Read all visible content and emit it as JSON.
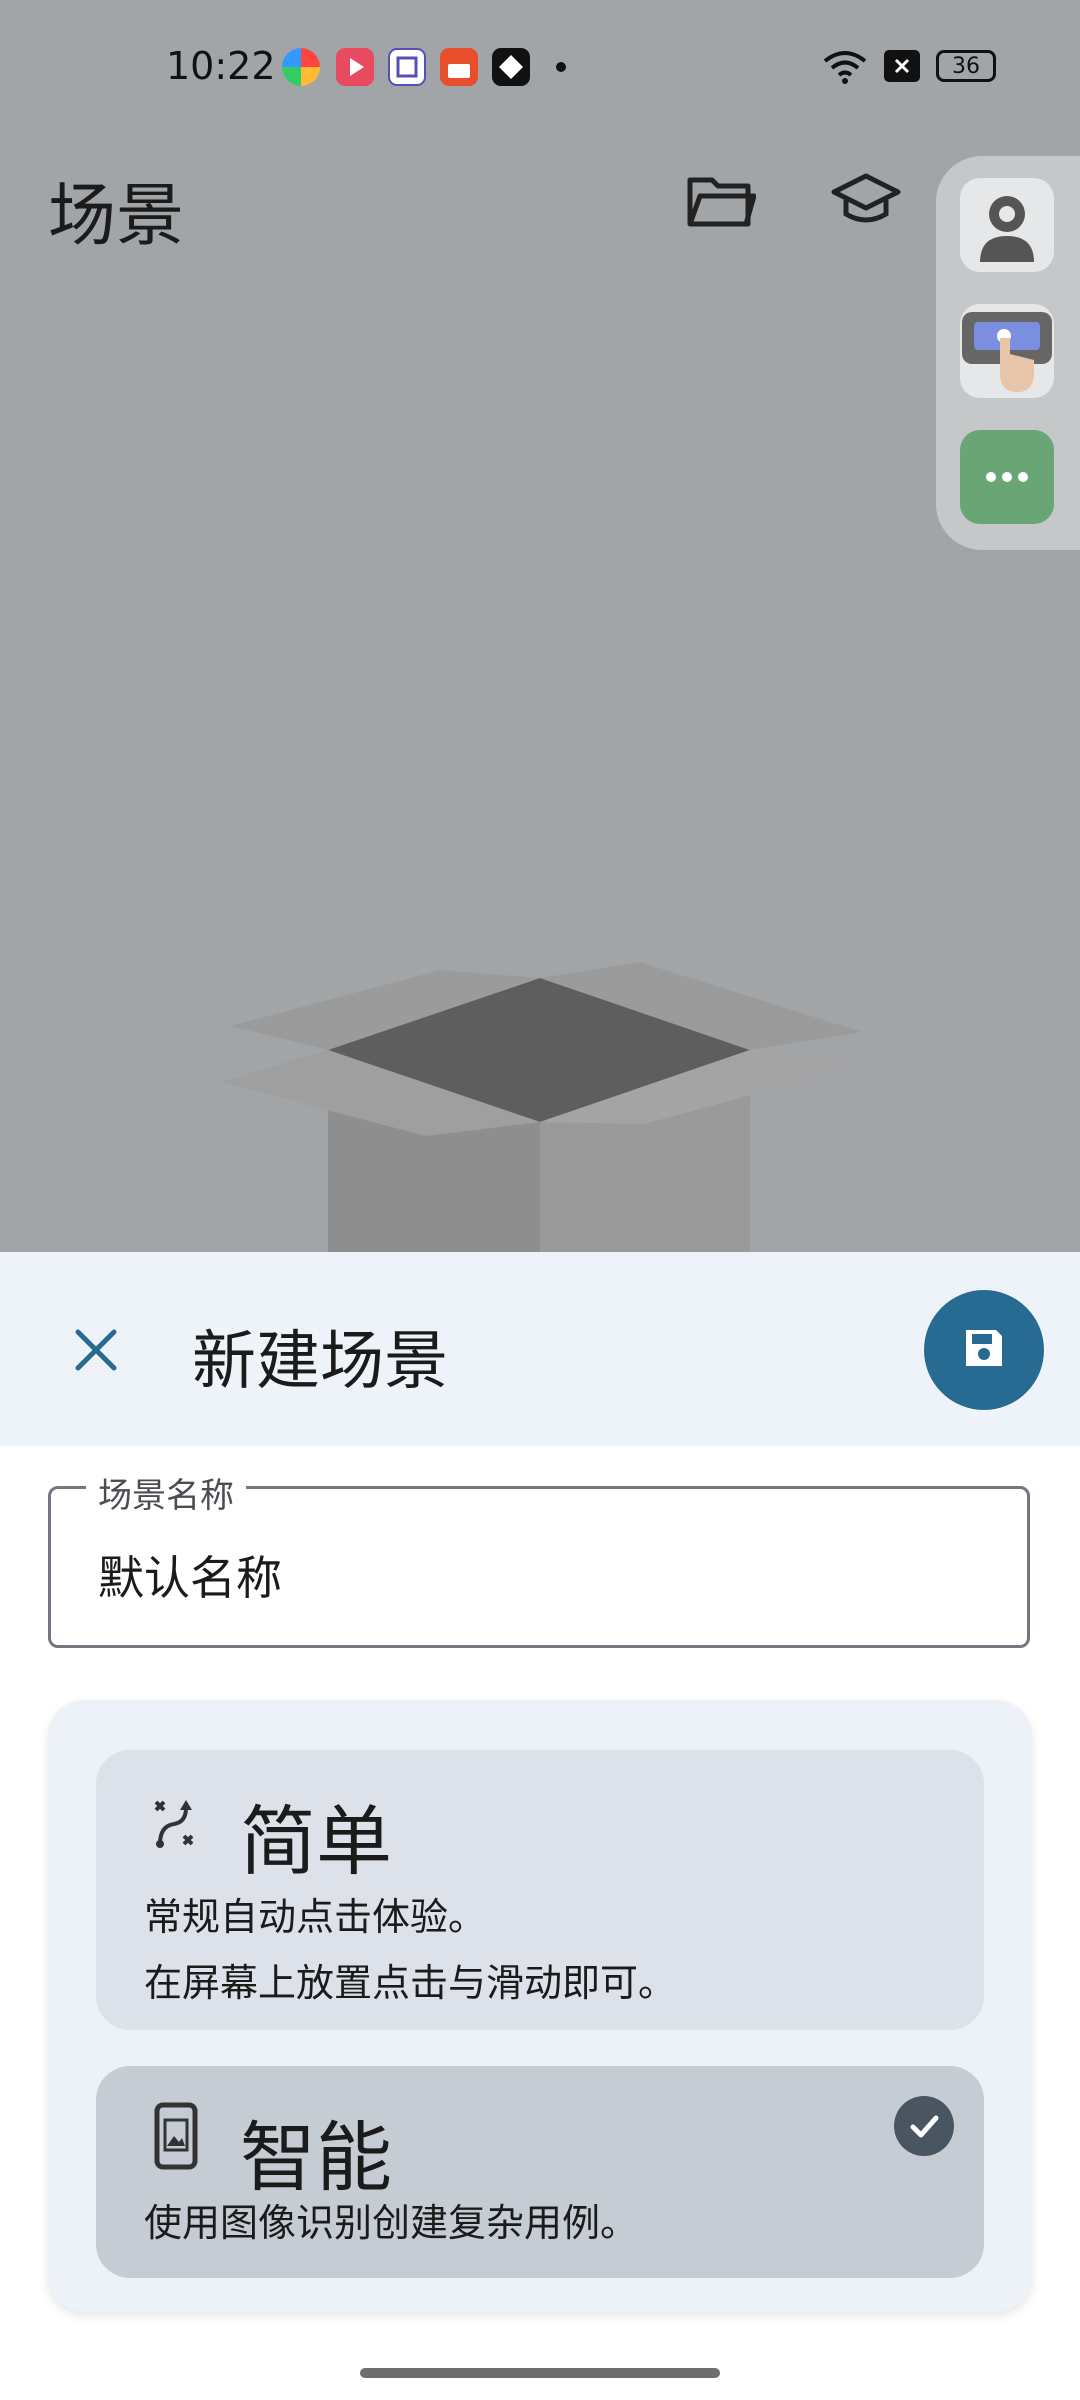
{
  "status_bar": {
    "time": "10:22",
    "battery": "36",
    "icons": [
      "app-icon-colorful",
      "video-app-icon",
      "tie-app-icon",
      "toolbox-app-icon",
      "bird-app-icon",
      "dot-icon",
      "wifi-icon",
      "sim-x-icon",
      "battery-icon"
    ]
  },
  "top_bar": {
    "title": "场景",
    "icons": [
      "folder-icon",
      "graduation-cap-icon"
    ]
  },
  "floating_menu": {
    "items": [
      "settings-person-icon",
      "click-hand-icon",
      "more-icon"
    ],
    "colors": {
      "more_bg": "#6aa575"
    }
  },
  "sheet": {
    "title": "新建场景",
    "close_icon": "close-icon",
    "save_icon": "save-icon",
    "name_field": {
      "label": "场景名称",
      "value": "默认名称"
    },
    "modes": [
      {
        "title": "简单",
        "icon": "swipe-gesture-icon",
        "line1": "常规自动点击体验。",
        "line2": "在屏幕上放置点击与滑动即可。",
        "selected": false
      },
      {
        "title": "智能",
        "icon": "phone-image-icon",
        "line1": "使用图像识别创建复杂用例。",
        "selected": true
      }
    ],
    "colors": {
      "accent": "#276b93",
      "check_bg": "#4a5562"
    }
  }
}
